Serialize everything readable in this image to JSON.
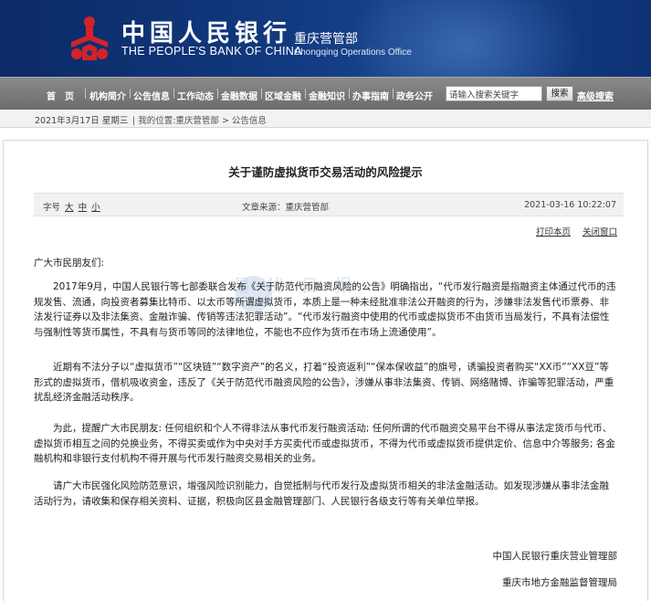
{
  "header": {
    "bank_name_cn": "中国人民银行",
    "bank_name_en": "THE PEOPLE'S BANK OF CHINA",
    "office_cn": "重庆营管部",
    "office_en": "Chongqing Operations Office",
    "logo_icon": "pboc-logo-icon"
  },
  "nav": {
    "items": [
      "首　页",
      "机构简介",
      "公告信息",
      "工作动态",
      "金融数据",
      "区域金融",
      "金融知识",
      "办事指南",
      "政务公开"
    ],
    "search_placeholder": "请输入搜索关键字",
    "search_button": "搜索",
    "advanced_search": "高级搜索"
  },
  "breadcrumb": {
    "date": "2021年3月17日  星期三",
    "location": "|  我的位置:重庆营管部 > 公告信息"
  },
  "article": {
    "title": "关于谨防虚拟货币交易活动的风险提示",
    "font_size_label": "字号",
    "font_sizes": [
      "大",
      "中",
      "小"
    ],
    "source": "文章来源：重庆营管部",
    "time": "2021-03-16 10:22:07",
    "print_label": "打印本页",
    "close_label": "关闭窗口",
    "watermark": "易 犹 日 报",
    "greeting": "广大市民朋友们:",
    "paragraphs": [
      "2017年9月，中国人民银行等七部委联合发布《关于防范代币融资风险的公告》明确指出，“代币发行融资是指融资主体通过代币的违规发售、流通，向投资者募集比特币、以太币等所谓虚拟货币，本质上是一种未经批准非法公开融资的行为，涉嫌非法发售代币票券、非法发行证券以及非法集资、金融诈骗、传销等违法犯罪活动”。“代币发行融资中使用的代币或虚拟货币不由货币当局发行，不具有法偿性与强制性等货币属性，不具有与货币等同的法律地位，不能也不应作为货币在市场上流通使用”。",
      "近期有不法分子以“虚拟货币”“区块链”“数字资产”的名义，打着“投资返利”“保本保收益”的旗号，诱骗投资者购买“XX币”“XX豆”等形式的虚拟货币，借机吸收资金，违反了《关于防范代币融资风险的公告》，涉嫌从事非法集资、传销、网络赌博、诈骗等犯罪活动，严重扰乱经济金融活动秩序。",
      "为此，提醒广大市民朋友: 任何组织和个人不得非法从事代币发行融资活动; 任何所谓的代币融资交易平台不得从事法定货币与代币、虚拟货币相互之间的兑换业务，不得买卖或作为中央对手方买卖代币或虚拟货币，不得为代币或虚拟货币提供定价、信息中介等服务; 各金融机构和非银行支付机构不得开展与代币发行融资交易相关的业务。",
      "请广大市民强化风险防范意识，增强风险识别能力，自觉抵制与代币发行及虚拟货币相关的非法金融活动。如发现涉嫌从事非法金融活动行为，请收集和保存相关资料、证据，积极向区县金融管理部门、人民银行各级支行等有关单位举报。"
    ],
    "signatures": [
      "中国人民银行重庆营业管理部",
      "重庆市地方金融监督管理局"
    ]
  },
  "colors": {
    "banner_blue": "#123a80",
    "nav_gray": "#7a7a7a",
    "logo_red": "#d2232a"
  }
}
